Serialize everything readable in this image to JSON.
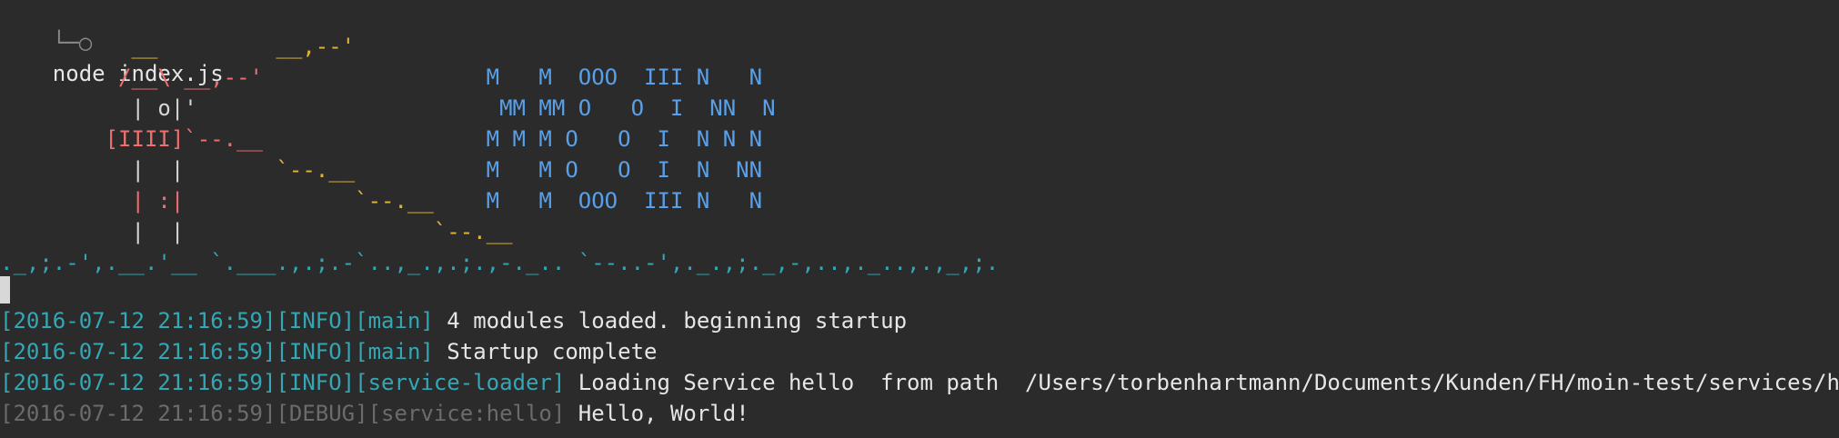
{
  "prompt": {
    "glyph": "└─○",
    "command": "node index.js"
  },
  "banner": {
    "rows": [
      [
        {
          "t": "          __         __,--'",
          "c": "art-yellow"
        }
      ],
      [
        {
          "t": "         /__\\ __,--'",
          "c": "art-red"
        },
        {
          "t": "                 M   M  OOO  III N   N",
          "c": "art-blue"
        }
      ],
      [
        {
          "t": "          | o|'",
          "c": "art-white"
        },
        {
          "t": "                       MM MM O   O  I  NN  N",
          "c": "art-blue"
        }
      ],
      [
        {
          "t": "        [IIII]`--.__",
          "c": "art-red"
        },
        {
          "t": "                 M M M O   O  I  N N N",
          "c": "art-blue"
        }
      ],
      [
        {
          "t": "          |  |",
          "c": "art-white"
        },
        {
          "t": "       `--.__",
          "c": "art-yellow"
        },
        {
          "t": "          M   M O   O  I  N  NN",
          "c": "art-blue"
        }
      ],
      [
        {
          "t": "          | :|",
          "c": "art-red"
        },
        {
          "t": "             `--.__",
          "c": "art-yellow"
        },
        {
          "t": "    M   M  OOO  III N   N",
          "c": "art-blue"
        }
      ],
      [
        {
          "t": "          |  |",
          "c": "art-white"
        },
        {
          "t": "                   `--.__",
          "c": "art-yellow"
        }
      ],
      [
        {
          "t": "._,;.-',.__.'__ `.___.,.;.-`..,_.,.;.,-._.. `--..-',._.,;._,-,..,._..,.,_,;.",
          "c": "ground"
        }
      ]
    ]
  },
  "logs": [
    {
      "timestamp": "[2016-07-12 21:16:59]",
      "level": "[INFO]",
      "module": "[main]",
      "message": "4 modules loaded. beginning startup",
      "dim": false
    },
    {
      "timestamp": "[2016-07-12 21:16:59]",
      "level": "[INFO]",
      "module": "[main]",
      "message": "Startup complete",
      "dim": false
    },
    {
      "timestamp": "[2016-07-12 21:16:59]",
      "level": "[INFO]",
      "module": "[service-loader]",
      "message": "Loading Service hello  from path  /Users/torbenhartmann/Documents/Kunden/FH/moin-test/services/hello",
      "dim": false
    },
    {
      "timestamp": "[2016-07-12 21:16:59]",
      "level": "[DEBUG]",
      "module": "[service:hello]",
      "message": "Hello, World!",
      "dim": true
    }
  ],
  "colors": {
    "background": "#2b2b2b",
    "teal": "#33a7b5",
    "blue": "#5aa0e8",
    "red": "#ee6f6f",
    "yellow": "#e0b43a"
  }
}
